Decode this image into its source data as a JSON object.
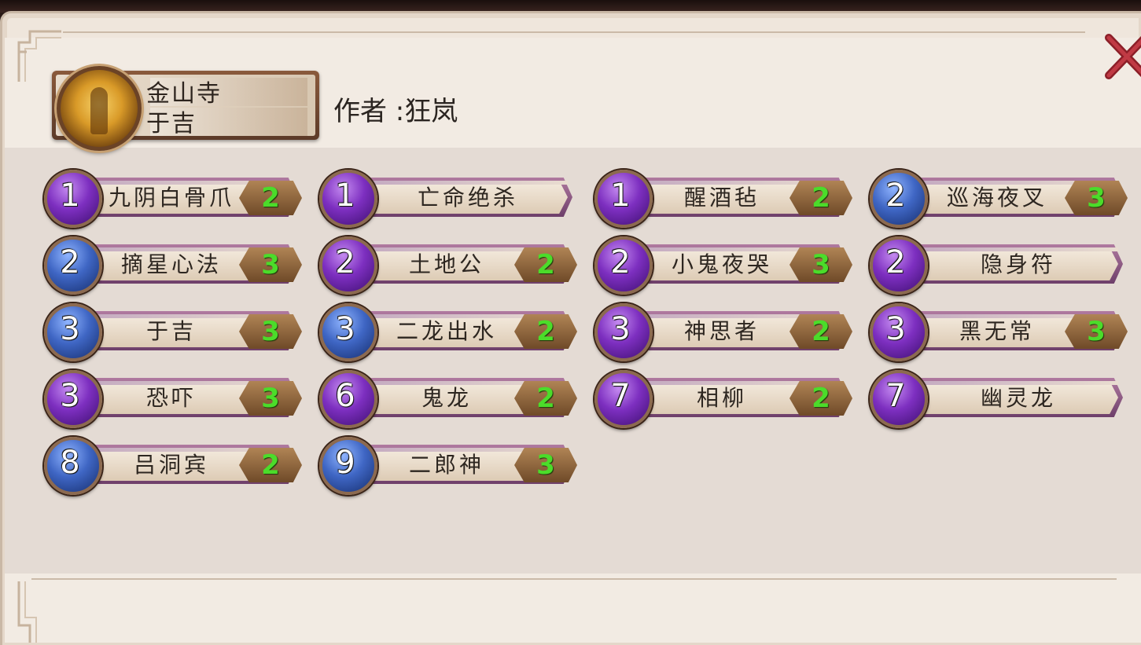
{
  "hero": {
    "name_line1": "金山寺",
    "name_line2": "于吉",
    "portrait_icon": "monk-portrait-icon"
  },
  "author_text": "作者 :狂岚",
  "close_icon": "close-x-icon",
  "colors": {
    "purple_badge": "#7d2fc0",
    "blue_badge": "#3f66c4",
    "cost_text": "#4bdc2a",
    "panel_bg": "#efe6dc",
    "content_bg": "#e4dbd4"
  },
  "cards": [
    {
      "cost_star": "1",
      "badge": "purple",
      "name": "九阴白骨爪",
      "count": "2"
    },
    {
      "cost_star": "1",
      "badge": "purple",
      "name": "亡命绝杀",
      "count": ""
    },
    {
      "cost_star": "1",
      "badge": "purple",
      "name": "醒酒毡",
      "count": "2"
    },
    {
      "cost_star": "2",
      "badge": "blue",
      "name": "巡海夜叉",
      "count": "3"
    },
    {
      "cost_star": "2",
      "badge": "blue",
      "name": "摘星心法",
      "count": "3"
    },
    {
      "cost_star": "2",
      "badge": "purple",
      "name": "土地公",
      "count": "2"
    },
    {
      "cost_star": "2",
      "badge": "purple",
      "name": "小鬼夜哭",
      "count": "3"
    },
    {
      "cost_star": "2",
      "badge": "purple",
      "name": "隐身符",
      "count": ""
    },
    {
      "cost_star": "3",
      "badge": "blue",
      "name": "于吉",
      "count": "3"
    },
    {
      "cost_star": "3",
      "badge": "blue",
      "name": "二龙出水",
      "count": "2"
    },
    {
      "cost_star": "3",
      "badge": "purple",
      "name": "神思者",
      "count": "2"
    },
    {
      "cost_star": "3",
      "badge": "purple",
      "name": "黑无常",
      "count": "3"
    },
    {
      "cost_star": "3",
      "badge": "purple",
      "name": "恐吓",
      "count": "3"
    },
    {
      "cost_star": "6",
      "badge": "purple",
      "name": "鬼龙",
      "count": "2"
    },
    {
      "cost_star": "7",
      "badge": "purple",
      "name": "相柳",
      "count": "2"
    },
    {
      "cost_star": "7",
      "badge": "purple",
      "name": "幽灵龙",
      "count": ""
    },
    {
      "cost_star": "8",
      "badge": "blue",
      "name": "吕洞宾",
      "count": "2"
    },
    {
      "cost_star": "9",
      "badge": "blue",
      "name": "二郎神",
      "count": "3"
    }
  ]
}
